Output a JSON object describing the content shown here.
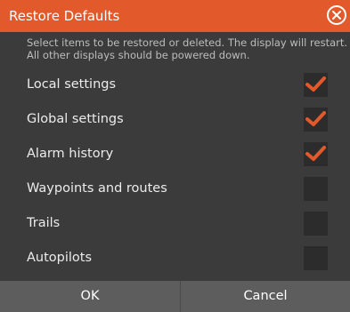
{
  "dialog": {
    "title": "Restore Defaults",
    "close_icon": "close-circle-icon",
    "description": [
      "Select items to be restored or deleted. The display will restart.",
      "All other displays should be powered down."
    ],
    "items": [
      {
        "label": "Local settings",
        "checked": true
      },
      {
        "label": "Global settings",
        "checked": true
      },
      {
        "label": "Alarm history",
        "checked": true
      },
      {
        "label": "Waypoints and routes",
        "checked": false
      },
      {
        "label": "Trails",
        "checked": false
      },
      {
        "label": "Autopilots",
        "checked": false
      }
    ],
    "buttons": {
      "ok": "OK",
      "cancel": "Cancel"
    }
  },
  "colors": {
    "accent": "#e2592b",
    "background": "#3b3b3b",
    "footer": "#5d5d5d",
    "checkbox": "#2c2c2c"
  }
}
